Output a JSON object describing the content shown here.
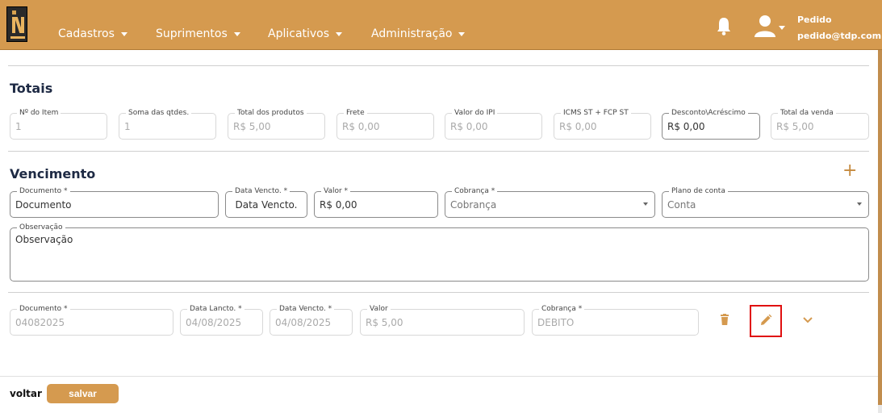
{
  "header": {
    "logo_text": "IN",
    "nav": [
      "Cadastros",
      "Suprimentos",
      "Aplicativos",
      "Administração"
    ],
    "user_name": "Pedido",
    "user_email": "pedido@tdp.com.br"
  },
  "totais": {
    "title": "Totais",
    "fields": [
      {
        "label": "Nº do Item",
        "value": "1"
      },
      {
        "label": "Soma das qtdes.",
        "value": "1"
      },
      {
        "label": "Total dos produtos",
        "value": "R$ 5,00"
      },
      {
        "label": "Frete",
        "value": "R$ 0,00"
      },
      {
        "label": "Valor do IPI",
        "value": "R$ 0,00"
      },
      {
        "label": "ICMS ST + FCP ST",
        "value": "R$ 0,00"
      },
      {
        "label": "Desconto\\Acréscimo",
        "value": "R$ 0,00"
      },
      {
        "label": "Total da venda",
        "value": "R$ 5,00"
      }
    ]
  },
  "vencimento": {
    "title": "Vencimento",
    "form": {
      "documento": {
        "label": "Documento *",
        "placeholder": "Documento"
      },
      "data_vencto": {
        "label": "Data Vencto. *",
        "placeholder": "Data Vencto."
      },
      "valor": {
        "label": "Valor *",
        "value": "R$ 0,00"
      },
      "cobranca": {
        "label": "Cobrança *",
        "placeholder": "Cobrança"
      },
      "plano_conta": {
        "label": "Plano de conta",
        "placeholder": "Conta"
      },
      "observacao": {
        "label": "Observação",
        "placeholder": "Observação"
      }
    },
    "row": {
      "documento": {
        "label": "Documento *",
        "value": "04082025"
      },
      "data_lancto": {
        "label": "Data Lancto. *",
        "value": "04/08/2025"
      },
      "data_vencto": {
        "label": "Data Vencto. *",
        "value": "04/08/2025"
      },
      "valor": {
        "label": "Valor",
        "value": "R$ 5,00"
      },
      "cobranca": {
        "label": "Cobrança *",
        "value": "DEBITO"
      }
    }
  },
  "footer": {
    "voltar": "voltar",
    "salvar": "salvar"
  },
  "colors": {
    "brand": "#d59a4f",
    "highlight": "#e01010"
  }
}
